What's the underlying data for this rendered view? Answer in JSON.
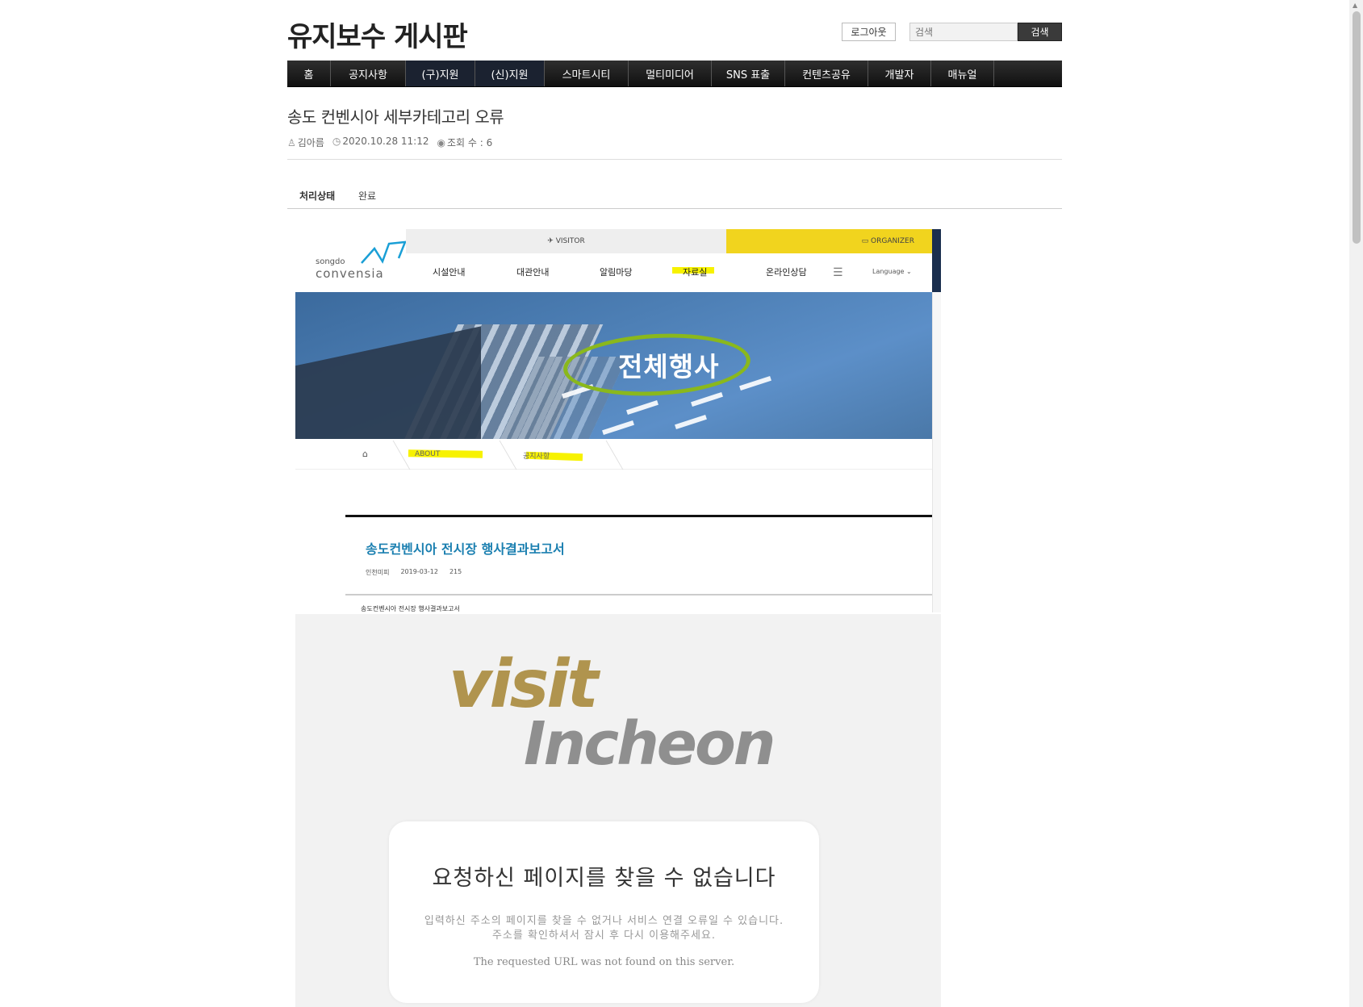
{
  "header": {
    "site_title": "유지보수 게시판",
    "logout_label": "로그아웃",
    "search_placeholder": "검색",
    "search_button": "검색"
  },
  "nav": {
    "items": [
      "홈",
      "공지사항",
      "(구)지원",
      "(신)지원",
      "스마트시티",
      "멀티미디어",
      "SNS 표출",
      "컨텐츠공유",
      "개발자",
      "매뉴얼"
    ]
  },
  "post": {
    "title": "송도 컨벤시아 세부카테고리 오류",
    "author": "김아름",
    "datetime": "2020.10.28 11:12",
    "views": "조회 수 : 6",
    "status_label": "처리상태",
    "status_value": "완료"
  },
  "shot1": {
    "logo_small": "songdo",
    "logo_big": "convensia",
    "visitor": "VISITOR",
    "organizer": "ORGANIZER",
    "menu": [
      "시설안내",
      "대관안내",
      "알림마당",
      "자료실",
      "온라인상담"
    ],
    "language": "Language",
    "banner_text": "전체행사",
    "breadcrumb_1": "ABOUT",
    "breadcrumb_2": "공지사항",
    "article_title": "송도컨벤시아 전시장 행사결과보고서",
    "article_author": "인천미피",
    "article_date": "2019-03-12",
    "article_views": "215",
    "article_body": "송도컨벤시아 전시장 행사결과보고서"
  },
  "shot2": {
    "logo_visit": "visit",
    "logo_incheon": "Incheon",
    "error_heading": "요청하신 페이지를 찾을 수 없습니다",
    "error_line1": "입력하신 주소의 페이지를 찾을 수 없거나 서비스 연결 오류일 수 있습니다.",
    "error_line2": "주소를 확인하셔서 잠시 후 다시 이용해주세요.",
    "error_en": "The requested URL was not found on this server."
  },
  "colors": {
    "nav_bg": "#1a1a1a",
    "nav_selected": "#1b2230",
    "organizer_yellow": "#f1d41e",
    "highlight_yellow": "#f7f200",
    "circle_green": "#8ab81c",
    "article_title_blue": "#1a7fb0",
    "visit_gold": "#b0944e",
    "incheon_gray": "#8f8f8f"
  }
}
